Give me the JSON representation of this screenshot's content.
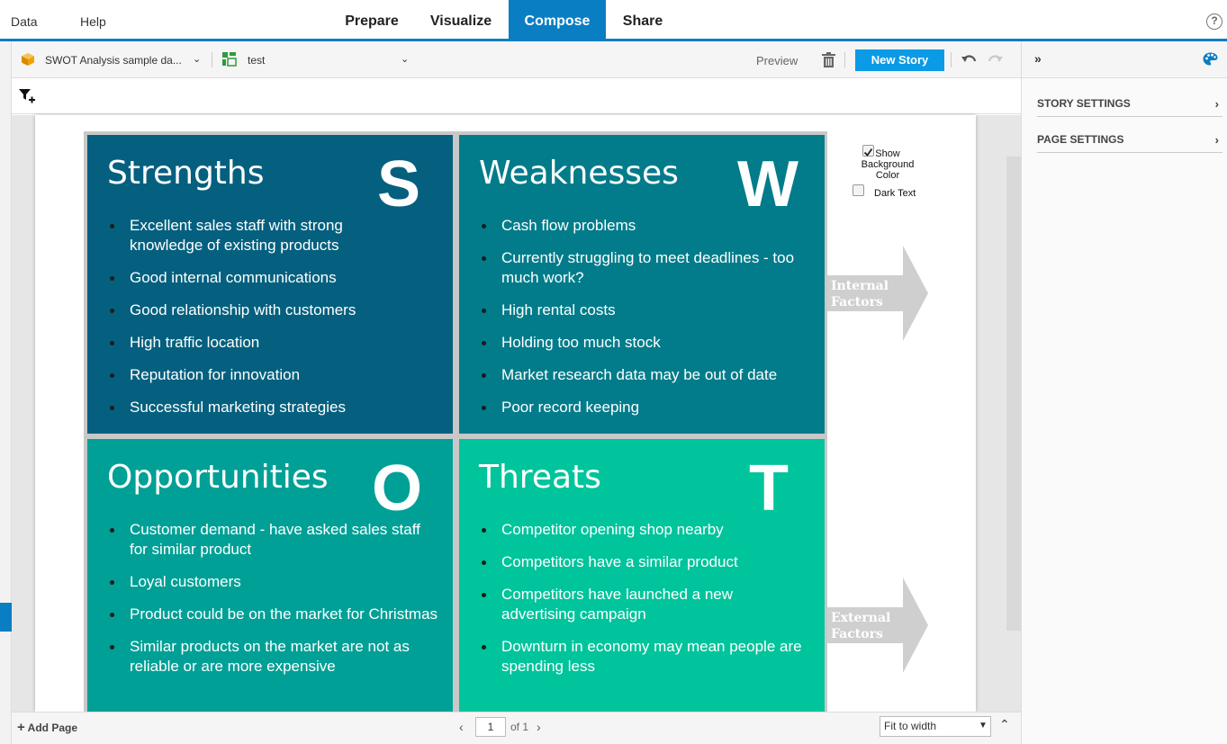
{
  "topbar": {
    "data_label": "Data",
    "help_label": "Help",
    "tabs": [
      {
        "label": "Prepare"
      },
      {
        "label": "Visualize"
      },
      {
        "label": "Compose"
      },
      {
        "label": "Share"
      }
    ],
    "active_tab": "Compose",
    "help_icon": "?"
  },
  "toolbar": {
    "dataset_name": "SWOT Analysis sample da...",
    "story_name": "test",
    "preview_label": "Preview",
    "new_story_label": "New Story"
  },
  "canvas": {
    "show_bg_label": "Show Background Color",
    "show_bg_checked": true,
    "dark_text_label": "Dark Text",
    "dark_text_checked": false,
    "arrow_internal": "Internal Factors",
    "arrow_external": "External Factors",
    "swot": {
      "strengths": {
        "title": "Strengths",
        "letter": "S",
        "color": "#05607f",
        "items": [
          "Excellent sales staff with strong knowledge of existing products",
          "Good internal communications",
          "Good relationship with customers",
          "High traffic location",
          "Reputation for innovation",
          "Successful marketing strategies"
        ]
      },
      "weaknesses": {
        "title": "Weaknesses",
        "letter": "W",
        "color": "#027c8a",
        "items": [
          "Cash flow problems",
          "Currently struggling to meet deadlines - too much work?",
          "High rental costs",
          "Holding too much stock",
          "Market research data may be out of date",
          "Poor record keeping"
        ]
      },
      "opportunities": {
        "title": "Opportunities",
        "letter": "O",
        "color": "#00a096",
        "items": [
          "Customer demand - have asked sales staff for similar product",
          "Loyal customers",
          "Product could be on the market for Christmas",
          "Similar products on the market are not as reliable or are more expensive"
        ]
      },
      "threats": {
        "title": "Threats",
        "letter": "T",
        "color": "#00c49b",
        "items": [
          "Competitor opening shop nearby",
          "Competitors have a similar product",
          "Competitors have launched a new advertising campaign",
          "Downturn in economy may mean people are spending less"
        ]
      }
    }
  },
  "bottombar": {
    "add_page_label": "Add Page",
    "page_current": "1",
    "page_of": "of 1",
    "zoom_value": "Fit to width"
  },
  "rightpanel": {
    "collapse_label": "»",
    "sections": [
      {
        "label": "STORY SETTINGS"
      },
      {
        "label": "PAGE SETTINGS"
      }
    ]
  },
  "colors": {
    "accent": "#0a7ec2",
    "new_story_button": "#0a9ae6"
  }
}
